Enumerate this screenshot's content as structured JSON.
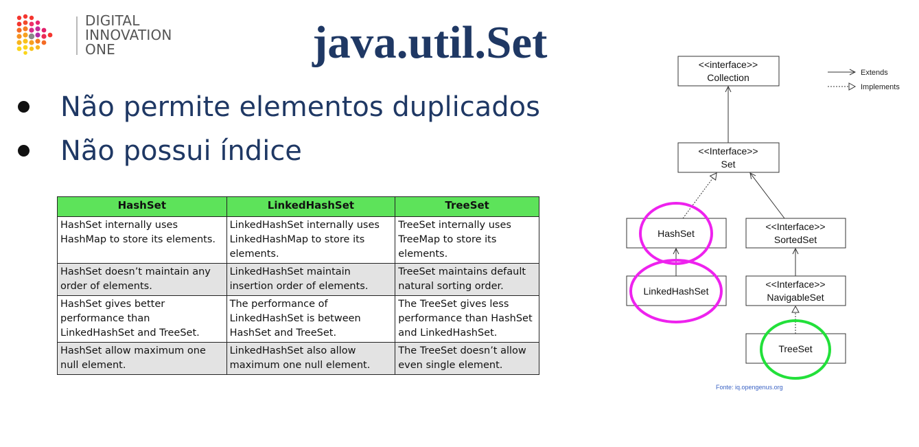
{
  "logo": {
    "lines": [
      "DIGITAL",
      "INNOVATION",
      "ONE"
    ]
  },
  "title": "java.util.Set",
  "bullets": [
    "Não permite elementos duplicados",
    "Não possui índice"
  ],
  "table": {
    "headers": [
      "HashSet",
      "LinkedHashSet",
      "TreeSet"
    ],
    "rows": [
      [
        "HashSet internally uses HashMap to store its elements.",
        "LinkedHashSet internally uses LinkedHashMap to store its elements.",
        "TreeSet internally uses TreeMap to store its elements."
      ],
      [
        "HashSet doesn’t maintain any order of elements.",
        "LinkedHashSet maintain insertion order of elements.",
        "TreeSet maintains default natural sorting order."
      ],
      [
        "HashSet gives better performance than LinkedHashSet and TreeSet.",
        "The performance of LinkedHashSet is between HashSet and TreeSet.",
        "The TreeSet gives less performance than HashSet and LinkedHashSet."
      ],
      [
        "HashSet allow maximum one null element.",
        "LinkedHashSet also allow maximum one null element.",
        "The TreeSet doesn’t allow even single element."
      ]
    ]
  },
  "diagram": {
    "nodes": {
      "collection": {
        "stereotype": "<<interface>>",
        "name": "Collection"
      },
      "set": {
        "stereotype": "<<Interface>>",
        "name": "Set"
      },
      "hashset": {
        "name": "HashSet"
      },
      "sortedset": {
        "stereotype": "<<Interface>>",
        "name": "SortedSet"
      },
      "linkedhashset": {
        "name": "LinkedHashSet"
      },
      "navigableset": {
        "stereotype": "<<Interface>>",
        "name": "NavigableSet"
      },
      "treeset": {
        "name": "TreeSet"
      }
    },
    "legend": {
      "extends": "Extends",
      "implements": "Implements"
    },
    "source": "Fonte: iq.opengenus.org",
    "colors": {
      "highlight_magenta": "#ee22ee",
      "highlight_green": "#22e03a",
      "text_blue": "#1f3864",
      "header_green": "#5de35a",
      "source_blue": "#3b63c4"
    }
  }
}
